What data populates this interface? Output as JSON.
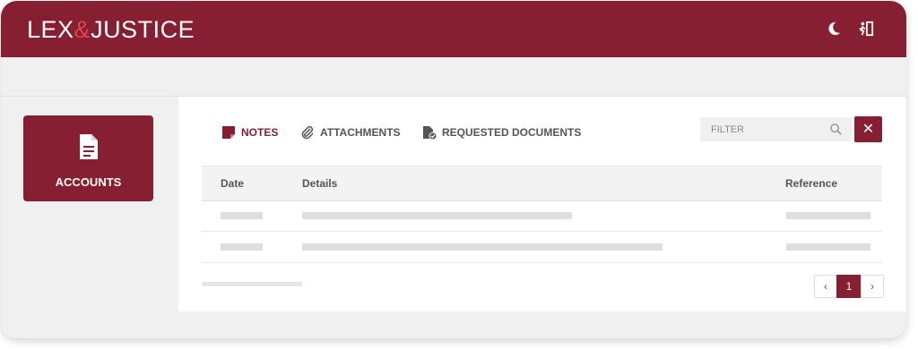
{
  "brand": {
    "part1": "LEX",
    "amp": "&",
    "part2": "JUSTICE"
  },
  "colors": {
    "primary": "#851f31",
    "accent": "#e04352"
  },
  "header_icons": [
    "moon-icon",
    "exit-icon"
  ],
  "sidebar": {
    "items": [
      {
        "label": "ACCOUNTS",
        "icon": "document-icon"
      }
    ]
  },
  "tabs": [
    {
      "label": "NOTES",
      "icon": "note-icon",
      "active": true
    },
    {
      "label": "ATTACHMENTS",
      "icon": "paperclip-icon",
      "active": false
    },
    {
      "label": "REQUESTED DOCUMENTS",
      "icon": "document-check-icon",
      "active": false
    }
  ],
  "filter": {
    "placeholder": "FILTER",
    "clear_label": "✕"
  },
  "table": {
    "columns": [
      "Date",
      "Details",
      "Reference"
    ]
  },
  "pagination": {
    "prev": "‹",
    "current": "1",
    "next": "›"
  }
}
